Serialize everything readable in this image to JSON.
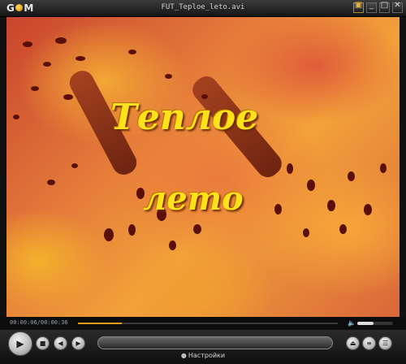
{
  "app": {
    "logo": "GOM",
    "title": "FUT_Teploe_leto.avi"
  },
  "window_buttons": {
    "fullscreen_icon": "fullscreen-icon",
    "minimize_icon": "minimize-icon",
    "maximize_icon": "maximize-icon",
    "close_icon": "close-icon",
    "fullscreen": "▣",
    "minimize": "_",
    "maximize": "□",
    "close": "✕"
  },
  "video": {
    "caption_line1": "Теплое",
    "caption_line2": "лето",
    "caption_color": "#ffe21a"
  },
  "seek": {
    "time": "00:00:06/00:00:36",
    "progress": 0.17,
    "accent": "#e89a1a"
  },
  "volume": {
    "level": 0.45,
    "icon": "speaker-icon"
  },
  "controls": {
    "play": "▶",
    "stop": "■",
    "prev": "◀",
    "next": "▶",
    "eject": "⏏",
    "playlist": "≡",
    "menu": "☰",
    "settings_label": "Настройки"
  }
}
